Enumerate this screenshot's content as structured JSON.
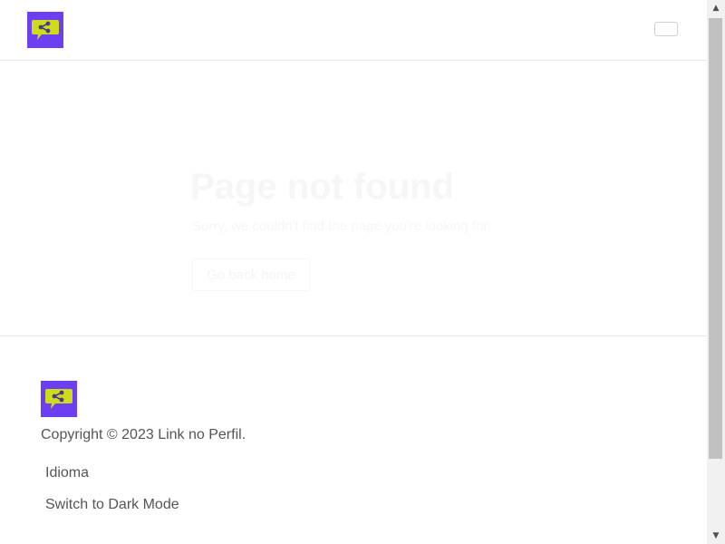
{
  "header": {
    "logo": {
      "icon": "share-chat-icon",
      "background": "#6c3ff0",
      "bubble_color": "#cfdc1b"
    },
    "menu_toggle_icon": "menu-toggle-icon"
  },
  "main": {
    "title": "Page not found",
    "subtitle": "Sorry, we couldn't find the page you're looking for.",
    "button_label": "Go back home"
  },
  "footer": {
    "logo": {
      "icon": "share-chat-icon"
    },
    "copyright": "Copyright © 2023 Link no Perfil.",
    "links": {
      "language": "Idioma",
      "dark_mode": "Switch to Dark Mode"
    }
  },
  "scrollbar": {
    "up_icon": "▲",
    "down_icon": "▼"
  }
}
